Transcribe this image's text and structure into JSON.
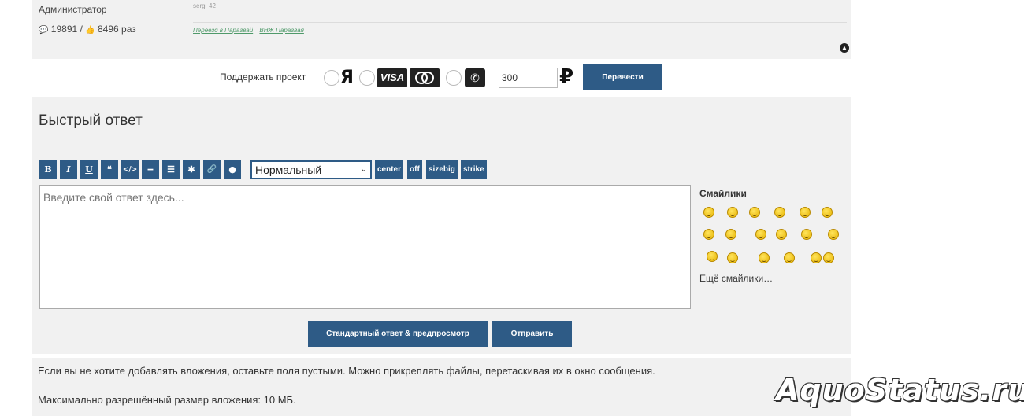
{
  "post": {
    "author_rank": "Администратор",
    "author_posts": "19891",
    "author_likes": "8496 раз",
    "signature_user": "serg_42",
    "signature_links": [
      "Переезд в Парагвай",
      "ВНЖ Парагвая"
    ]
  },
  "donate": {
    "label": "Поддержать проект",
    "ya_logo": "Я",
    "visa_label": "VISA",
    "amount": "300",
    "currency_symbol": "₽",
    "transfer_label": "Перевести"
  },
  "reply": {
    "title": "Быстрый ответ",
    "toolbar": {
      "bold": "B",
      "italic": "I",
      "underline": "U",
      "quote": "❝",
      "code": "</>",
      "list": "≡",
      "ordered_list": "☰",
      "spoiler": "✱",
      "link": "🔗",
      "color": "●",
      "size_selected": "Нормальный",
      "center": "center",
      "off": "off",
      "sizebig": "sizebig",
      "strike": "strike"
    },
    "textarea_placeholder": "Введите свой ответ здесь...",
    "smilies_title": "Смайлики",
    "more_smilies": "Ещё смайлики…",
    "preview_label": "Стандартный ответ & предпросмотр",
    "send_label": "Отправить"
  },
  "attachments": {
    "note": "Если вы не хотите добавлять вложения, оставьте поля пустыми. Можно прикреплять файлы, перетаскивая их в окно сообщения.",
    "max_size": "Максимально разрешённый размер вложения: 10 МБ."
  },
  "watermark": "AquoStatus.ru",
  "colors": {
    "button": "#2e5b86",
    "panel": "#f1f1f1"
  }
}
